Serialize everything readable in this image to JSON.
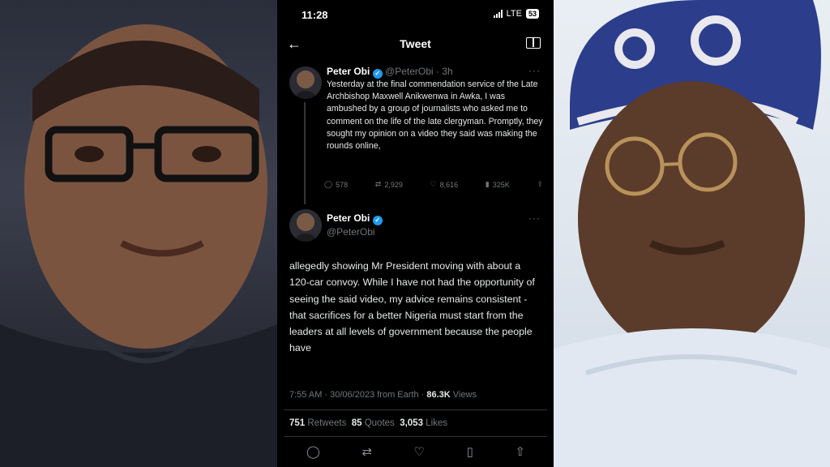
{
  "status": {
    "time": "11:28",
    "network": "LTE",
    "battery": "53"
  },
  "header": {
    "title": "Tweet"
  },
  "tweet1": {
    "name": "Peter Obi",
    "handle": "@PeterObi",
    "age": "· 3h",
    "text": "Yesterday at the final commendation service of the Late Archbishop Maxwell Anikwenwa in Awka, I was ambushed by a group of journalists who asked me to comment on the life of the late clergyman. Promptly, they sought my opinion on a video they said was making the rounds online,",
    "replies": "578",
    "retweets": "2,929",
    "likes": "8,616",
    "views": "325K"
  },
  "tweet2": {
    "name": "Peter Obi",
    "handle": "@PeterObi",
    "text": "allegedly showing Mr President moving with about a 120-car convoy. While I have not had the opportunity of seeing the said video, my advice remains consistent - that sacrifices for a better Nigeria must start from the leaders at all levels of government because the people have",
    "timestamp": "7:55 AM · 30/06/2023 from Earth ·",
    "views_count": "86.3K",
    "views_label": "Views",
    "retweets_count": "751",
    "retweets_label": "Retweets",
    "quotes_count": "85",
    "quotes_label": "Quotes",
    "likes_count": "3,053",
    "likes_label": "Likes"
  },
  "icons": {
    "reply": "reply-icon",
    "retweet": "retweet-icon",
    "like": "heart-icon",
    "views": "views-icon",
    "share": "share-icon",
    "bookmark": "bookmark-icon",
    "back": "back-arrow-icon",
    "reader": "reader-icon",
    "verified": "verified-badge-icon"
  },
  "colors": {
    "background": "#000000",
    "text": "#e7e9ea",
    "muted": "#71767b",
    "verified": "#1d9bf0"
  }
}
